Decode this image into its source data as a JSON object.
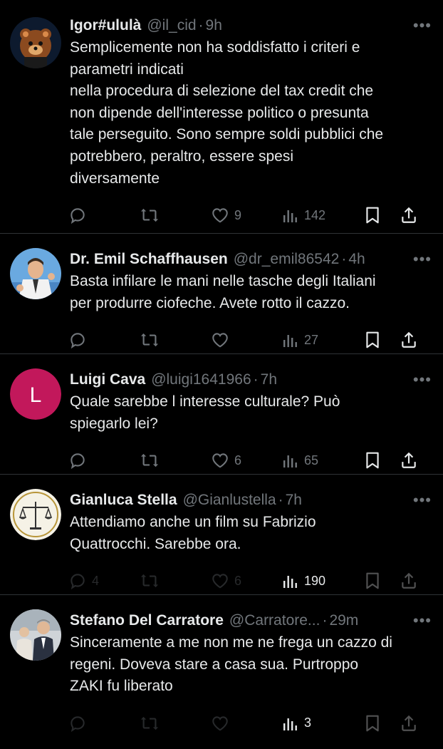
{
  "tweets": [
    {
      "name": "Igor#ululà",
      "handle": "@il_cid",
      "time": "9h",
      "text": "Semplicemente non ha soddisfatto i criteri e\nparametri indicati\nnella procedura di selezione del tax credit che\nnon dipende dell'interesse politico o presunta\ntale perseguito. Sono sempre soldi pubblici che\npotrebbero, peraltro, essere spesi\ndiversamente",
      "replies": "",
      "retweets": "",
      "likes": "9",
      "views": "142",
      "avatar": "bear-avatar"
    },
    {
      "name": "Dr. Emil Schaffhausen",
      "handle": "@dr_emil86542",
      "time": "4h",
      "text": "Basta infilare le mani nelle tasche degli Italiani\nper produrre ciofeche. Avete rotto il cazzo.",
      "replies": "",
      "retweets": "",
      "likes": "",
      "views": "27",
      "avatar": "man-suit-avatar"
    },
    {
      "name": "Luigi Cava",
      "handle": "@luigi1641966",
      "time": "7h",
      "text": "Quale sarebbe l interesse culturale? Può\nspiegarlo lei?",
      "replies": "",
      "retweets": "",
      "likes": "6",
      "views": "65",
      "avatar": "letter-avatar",
      "avatar_letter": "L",
      "avatar_color": "#c2185b"
    },
    {
      "name": "Gianluca Stella",
      "handle": "@Gianlustella",
      "time": "7h",
      "text": "Attendiamo anche un film su Fabrizio\nQuattrocchi. Sarebbe ora.",
      "replies": "4",
      "retweets": "",
      "likes": "6",
      "views": "190",
      "avatar": "scales-avatar",
      "dimmed": true
    },
    {
      "name": "Stefano Del Carratore",
      "handle": "@Carratore...",
      "time": "29m",
      "text": "Sinceramente a me non me ne frega un cazzo di\nregeni. Doveva stare a casa sua. Purtroppo\nZAKI fu liberato",
      "replies": "",
      "retweets": "",
      "likes": "",
      "views": "3",
      "avatar": "photo-avatar",
      "dimmed": true
    }
  ],
  "dot": "·",
  "more": "•••"
}
